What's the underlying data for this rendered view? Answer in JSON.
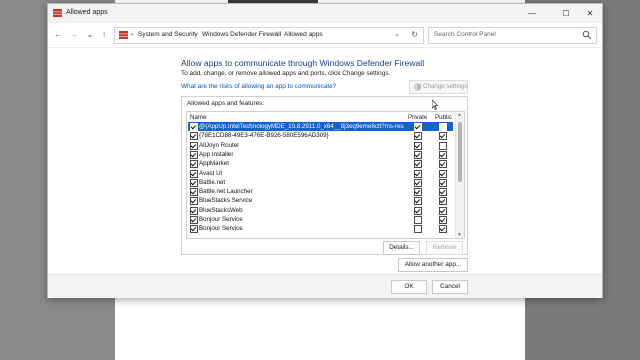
{
  "window": {
    "title": "Allowed apps",
    "minimize": "—",
    "maximize": "☐",
    "close": "✕"
  },
  "nav": {
    "back": "←",
    "forward": "→",
    "recent": "⌄",
    "up": "↑",
    "breadcrumb": [
      {
        "label": "«"
      },
      {
        "label": "System and Security"
      },
      {
        "label": "Windows Defender Firewall"
      },
      {
        "label": "Allowed apps"
      }
    ],
    "separator": "›",
    "dropdown": "⌄",
    "refresh": "↻",
    "search_placeholder": "Search Control Panel"
  },
  "main": {
    "heading": "Allow apps to communicate through Windows Defender Firewall",
    "subtext": "To add, change, or remove allowed apps and ports, click Change settings.",
    "risk_link": "What are the risks of allowing an app to communicate?",
    "change_settings": "Change settings",
    "group_label": "Allowed apps and features:",
    "columns": {
      "name": "Name",
      "private": "Private",
      "public": "Public"
    },
    "apps": [
      {
        "name": "@{AppUp.IntelTechnologyMDE_10.8.2911.0_x64__8j3eq9eme6ctt?ms-resource...",
        "enabled": true,
        "private": true,
        "public": false,
        "selected": true
      },
      {
        "name": "{78E1CD88-49E3-476E-B926-580E596AD309}",
        "enabled": true,
        "private": true,
        "public": true,
        "selected": false
      },
      {
        "name": "AllJoyn Router",
        "enabled": true,
        "private": true,
        "public": false,
        "selected": false
      },
      {
        "name": "App Installer",
        "enabled": true,
        "private": true,
        "public": true,
        "selected": false
      },
      {
        "name": "AppMarket",
        "enabled": true,
        "private": true,
        "public": true,
        "selected": false
      },
      {
        "name": "Avast UI",
        "enabled": true,
        "private": true,
        "public": true,
        "selected": false
      },
      {
        "name": "Battle.net",
        "enabled": true,
        "private": true,
        "public": true,
        "selected": false
      },
      {
        "name": "Battle.net Launcher",
        "enabled": true,
        "private": true,
        "public": true,
        "selected": false
      },
      {
        "name": "BlueStacks Service",
        "enabled": true,
        "private": true,
        "public": true,
        "selected": false
      },
      {
        "name": "BlueStacksWeb",
        "enabled": true,
        "private": true,
        "public": true,
        "selected": false
      },
      {
        "name": "Bonjour Service",
        "enabled": true,
        "private": false,
        "public": true,
        "selected": false
      },
      {
        "name": "Bonjour Service",
        "enabled": true,
        "private": false,
        "public": true,
        "selected": false
      }
    ],
    "details": "Details...",
    "remove": "Remove",
    "allow_another": "Allow another app..."
  },
  "footer": {
    "ok": "OK",
    "cancel": "Cancel"
  },
  "colors": {
    "accent": "#1361d4",
    "heading": "#1e3e8a",
    "link": "#0b57b5"
  }
}
